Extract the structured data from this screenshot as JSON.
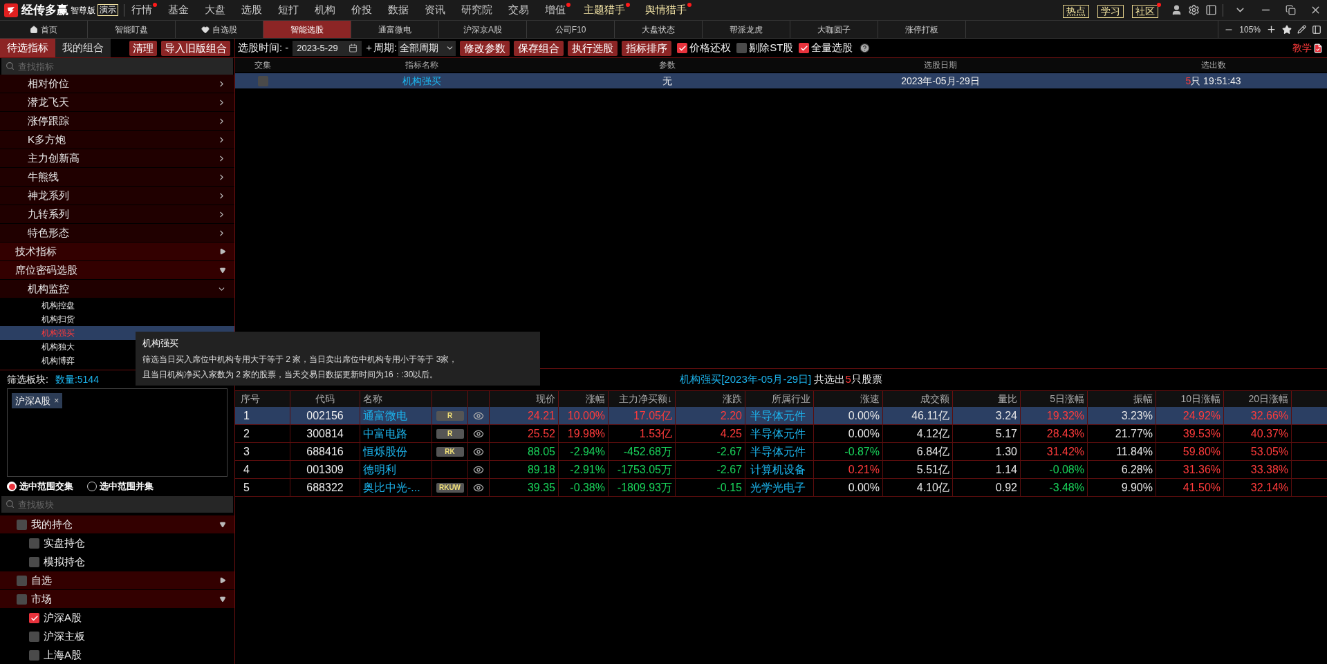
{
  "app": {
    "name": "经传多赢",
    "edition": "智尊版",
    "badge": "演示"
  },
  "menu": [
    {
      "label": "行情",
      "dot": true,
      "kind": "plain"
    },
    {
      "label": "基金",
      "dot": false,
      "kind": "plain"
    },
    {
      "label": "大盘",
      "dot": false,
      "kind": "plain"
    },
    {
      "label": "选股",
      "dot": false,
      "kind": "plain"
    },
    {
      "label": "短打",
      "dot": false,
      "kind": "plain"
    },
    {
      "label": "机构",
      "dot": false,
      "kind": "plain"
    },
    {
      "label": "价投",
      "dot": false,
      "kind": "plain"
    },
    {
      "label": "数据",
      "dot": false,
      "kind": "plain"
    },
    {
      "label": "资讯",
      "dot": false,
      "kind": "plain"
    },
    {
      "label": "研究院",
      "dot": false,
      "kind": "plain"
    },
    {
      "label": "交易",
      "dot": false,
      "kind": "plain"
    },
    {
      "label": "增值",
      "dot": true,
      "kind": "plain"
    },
    {
      "label": "主题猎手",
      "dot": true,
      "kind": "highlight"
    },
    {
      "label": "舆情猎手",
      "dot": true,
      "kind": "highlight"
    }
  ],
  "quick_links": [
    {
      "label": "热点",
      "dot": false
    },
    {
      "label": "学习",
      "dot": false
    },
    {
      "label": "社区",
      "dot": true
    }
  ],
  "tabs": [
    {
      "label": "首页",
      "selected": false,
      "kind": "home"
    },
    {
      "label": "智能盯盘",
      "selected": false,
      "kind": "plain"
    },
    {
      "label": "自选股",
      "selected": false,
      "kind": "heart"
    },
    {
      "label": "智能选股",
      "selected": true,
      "kind": "plain"
    },
    {
      "label": "通富微电",
      "selected": false,
      "kind": "plain"
    },
    {
      "label": "沪深京A股",
      "selected": false,
      "kind": "plain"
    },
    {
      "label": "公司F10",
      "selected": false,
      "kind": "plain"
    },
    {
      "label": "大盘状态",
      "selected": false,
      "kind": "plain"
    },
    {
      "label": "帮派龙虎",
      "selected": false,
      "kind": "plain"
    },
    {
      "label": "大咖圆子",
      "selected": false,
      "kind": "plain"
    },
    {
      "label": "涨停打板",
      "selected": false,
      "kind": "plain"
    }
  ],
  "zoom": "105%",
  "left_tabs": [
    {
      "label": "待选指标",
      "selected": true
    },
    {
      "label": "我的组合",
      "selected": false
    }
  ],
  "left_buttons": [
    "清理",
    "导入旧版组合"
  ],
  "toolbar": {
    "date_label": "选股时间: -",
    "date": "2023-5-29",
    "plus": "+",
    "period_label": "周期:",
    "period": "全部周期",
    "buttons": [
      "修改参数",
      "保存组合",
      "执行选股",
      "指标排序"
    ],
    "options": [
      {
        "label": "价格还权",
        "checked": true
      },
      {
        "label": "剔除ST股",
        "checked": false
      },
      {
        "label": "全量选股",
        "checked": true
      }
    ],
    "teach": "教学"
  },
  "indicator_search": {
    "placeholder": "查找指标"
  },
  "indicator_tree": {
    "continued": [
      {
        "label": "相对价位",
        "expanded": false
      },
      {
        "label": "潜龙飞天",
        "expanded": false
      },
      {
        "label": "涨停跟踪",
        "expanded": false
      },
      {
        "label": "K多方炮",
        "expanded": false
      },
      {
        "label": "主力创新高",
        "expanded": false
      },
      {
        "label": "牛熊线",
        "expanded": false
      },
      {
        "label": "神龙系列",
        "expanded": false
      },
      {
        "label": "九转系列",
        "expanded": false
      },
      {
        "label": "特色形态",
        "expanded": false
      }
    ],
    "nodes": [
      {
        "label": "技术指标",
        "expanded": false
      },
      {
        "label": "席位密码选股",
        "expanded": true,
        "children": [
          {
            "label": "机构监控",
            "expanded": true,
            "children": [
              {
                "label": "机构控盘",
                "selected": false
              },
              {
                "label": "机构扫货",
                "selected": false
              },
              {
                "label": "机构强买",
                "selected": true
              },
              {
                "label": "机构独大",
                "selected": false
              },
              {
                "label": "机构博弈",
                "selected": false
              }
            ]
          }
        ]
      }
    ]
  },
  "tooltip": {
    "title": "机构强买",
    "lines": [
      "筛选当日买入席位中机构专用大于等于 2 家，当日卖出席位中机构专用小于等于 3家，",
      "且当日机构净买入家数为 2 家的股票，当天交易日数据更新时间为16：:30以后。"
    ]
  },
  "filter": {
    "label": "筛选板块:",
    "count": "数量:5144",
    "tags": [
      {
        "label": "沪深A股",
        "remove": "×"
      }
    ],
    "modes": [
      {
        "label": "选中范围交集",
        "selected": true
      },
      {
        "label": "选中范围并集",
        "selected": false
      }
    ]
  },
  "board_search": {
    "placeholder": "查找板块"
  },
  "board_tree": [
    {
      "label": "我的持仓",
      "expanded": true,
      "checked": false,
      "children": [
        {
          "label": "实盘持仓",
          "checked": false
        },
        {
          "label": "模拟持仓",
          "checked": false
        }
      ]
    },
    {
      "label": "自选",
      "expanded": false,
      "checked": false
    },
    {
      "label": "市场",
      "expanded": true,
      "checked": false,
      "children": [
        {
          "label": "沪深A股",
          "checked": true
        },
        {
          "label": "沪深主板",
          "checked": false
        },
        {
          "label": "上海A股",
          "checked": false
        }
      ]
    }
  ],
  "criteria_table": {
    "columns": [
      "交集",
      "指标名称",
      "参数",
      "选股日期",
      "选出数"
    ],
    "rows": [
      {
        "selected": true,
        "checked": false,
        "name": "机构强买",
        "param": "无",
        "date": "2023年-05月-29日",
        "count": "5",
        "unit": "只",
        "time": "19:51:43"
      }
    ]
  },
  "result_title": {
    "name": "机构强买[2023年-05月-29日]",
    "text": "共选出",
    "count": "5",
    "suffix": "只股票"
  },
  "stock_table": {
    "columns": [
      "序号",
      "代码",
      "名称",
      "现价",
      "涨幅",
      "主力净买额↓",
      "涨跌",
      "所属行业",
      "涨速",
      "成交额",
      "量比",
      "5日涨幅",
      "振幅",
      "10日涨幅",
      "20日涨幅"
    ],
    "rows": [
      {
        "selected": true,
        "no": "1",
        "code": "002156",
        "name": "通富微电",
        "tag": "R",
        "values": [
          {
            "text": "24.21",
            "color": "#ff3b3b"
          },
          {
            "text": "10.00%",
            "color": "#ff3b3b"
          },
          {
            "text": "17.05亿",
            "color": "#ff3b3b"
          },
          {
            "text": "2.20",
            "color": "#ff3b3b"
          },
          {
            "text": "半导体元件",
            "color": "#1cb5ee"
          },
          {
            "text": "0.00%",
            "color": "#e6e6e6"
          },
          {
            "text": "46.11亿",
            "color": "#e6e6e6"
          },
          {
            "text": "3.24",
            "color": "#e6e6e6"
          },
          {
            "text": "19.32%",
            "color": "#ff3b3b"
          },
          {
            "text": "3.23%",
            "color": "#e6e6e6"
          },
          {
            "text": "24.92%",
            "color": "#ff3b3b"
          },
          {
            "text": "32.66%",
            "color": "#ff3b3b"
          }
        ]
      },
      {
        "selected": false,
        "no": "2",
        "code": "300814",
        "name": "中富电路",
        "tag": "R",
        "values": [
          {
            "text": "25.52",
            "color": "#ff3b3b"
          },
          {
            "text": "19.98%",
            "color": "#ff3b3b"
          },
          {
            "text": "1.53亿",
            "color": "#ff3b3b"
          },
          {
            "text": "4.25",
            "color": "#ff3b3b"
          },
          {
            "text": "半导体元件",
            "color": "#1cb5ee"
          },
          {
            "text": "0.00%",
            "color": "#e6e6e6"
          },
          {
            "text": "4.12亿",
            "color": "#e6e6e6"
          },
          {
            "text": "5.17",
            "color": "#e6e6e6"
          },
          {
            "text": "28.43%",
            "color": "#ff3b3b"
          },
          {
            "text": "21.77%",
            "color": "#e6e6e6"
          },
          {
            "text": "39.53%",
            "color": "#ff3b3b"
          },
          {
            "text": "40.37%",
            "color": "#ff3b3b"
          }
        ]
      },
      {
        "selected": false,
        "no": "3",
        "code": "688416",
        "name": "恒烁股份",
        "tag": "RK",
        "values": [
          {
            "text": "88.05",
            "color": "#19d35a"
          },
          {
            "text": "-2.94%",
            "color": "#19d35a"
          },
          {
            "text": "-452.68万",
            "color": "#19d35a"
          },
          {
            "text": "-2.67",
            "color": "#19d35a"
          },
          {
            "text": "半导体元件",
            "color": "#1cb5ee"
          },
          {
            "text": "-0.87%",
            "color": "#19d35a"
          },
          {
            "text": "6.84亿",
            "color": "#e6e6e6"
          },
          {
            "text": "1.30",
            "color": "#e6e6e6"
          },
          {
            "text": "31.42%",
            "color": "#ff3b3b"
          },
          {
            "text": "11.84%",
            "color": "#e6e6e6"
          },
          {
            "text": "59.80%",
            "color": "#ff3b3b"
          },
          {
            "text": "53.05%",
            "color": "#ff3b3b"
          }
        ]
      },
      {
        "selected": false,
        "no": "4",
        "code": "001309",
        "name": "德明利",
        "values": [
          {
            "text": "89.18",
            "color": "#19d35a"
          },
          {
            "text": "-2.91%",
            "color": "#19d35a"
          },
          {
            "text": "-1753.05万",
            "color": "#19d35a"
          },
          {
            "text": "-2.67",
            "color": "#19d35a"
          },
          {
            "text": "计算机设备",
            "color": "#1cb5ee"
          },
          {
            "text": "0.21%",
            "color": "#ff3b3b"
          },
          {
            "text": "5.51亿",
            "color": "#e6e6e6"
          },
          {
            "text": "1.14",
            "color": "#e6e6e6"
          },
          {
            "text": "-0.08%",
            "color": "#19d35a"
          },
          {
            "text": "6.28%",
            "color": "#e6e6e6"
          },
          {
            "text": "31.36%",
            "color": "#ff3b3b"
          },
          {
            "text": "33.38%",
            "color": "#ff3b3b"
          }
        ]
      },
      {
        "selected": false,
        "no": "5",
        "code": "688322",
        "name": "奥比中光-...",
        "tag": "RKUW",
        "values": [
          {
            "text": "39.35",
            "color": "#19d35a"
          },
          {
            "text": "-0.38%",
            "color": "#19d35a"
          },
          {
            "text": "-1809.93万",
            "color": "#19d35a"
          },
          {
            "text": "-0.15",
            "color": "#19d35a"
          },
          {
            "text": "光学光电子",
            "color": "#1cb5ee"
          },
          {
            "text": "0.00%",
            "color": "#e6e6e6"
          },
          {
            "text": "4.10亿",
            "color": "#e6e6e6"
          },
          {
            "text": "0.92",
            "color": "#e6e6e6"
          },
          {
            "text": "-3.48%",
            "color": "#19d35a"
          },
          {
            "text": "9.90%",
            "color": "#e6e6e6"
          },
          {
            "text": "41.50%",
            "color": "#ff3b3b"
          },
          {
            "text": "32.14%",
            "color": "#ff3b3b"
          }
        ]
      }
    ]
  }
}
